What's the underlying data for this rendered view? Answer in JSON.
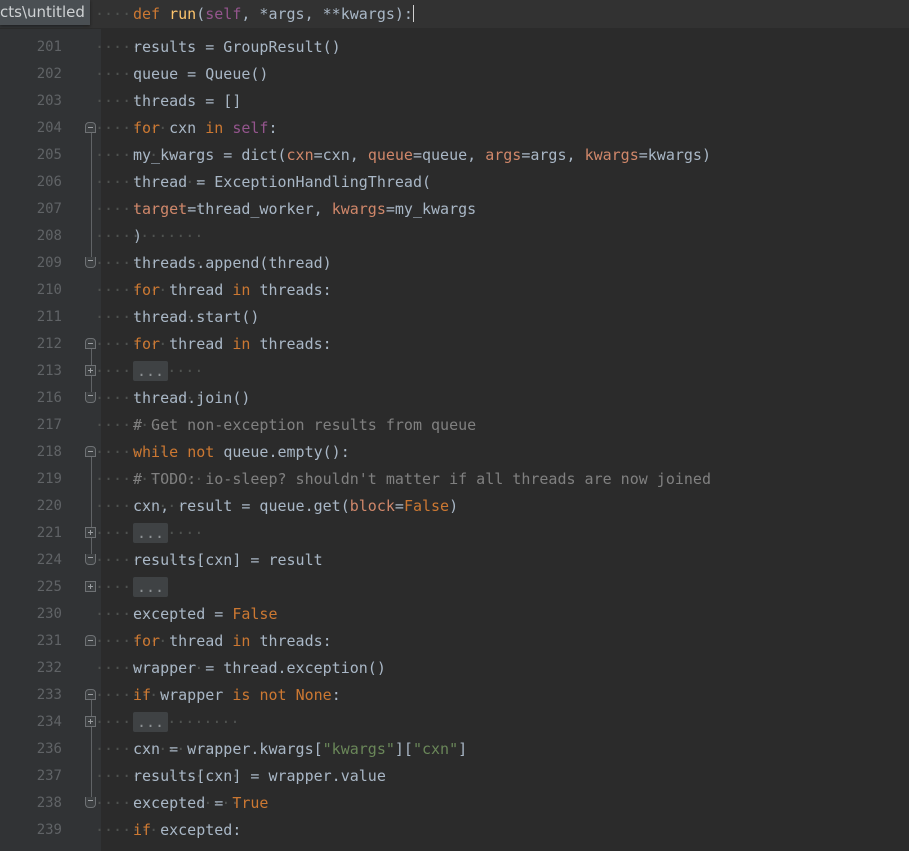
{
  "editor": {
    "language": "Python",
    "theme": "Darcula",
    "background": "#2b2b2b",
    "gutter_background": "#313335",
    "caret_color": "#d0d0d0"
  },
  "breadcrumb": {
    "text": "cts\\untitled"
  },
  "sticky_header": {
    "indent_guides": "····",
    "tokens": [
      {
        "t": "def ",
        "c": "kw"
      },
      {
        "t": "run",
        "c": "fn"
      },
      {
        "t": "(",
        "c": "op"
      },
      {
        "t": "self",
        "c": "self"
      },
      {
        "t": ", *args, **kwargs):",
        "c": "op"
      }
    ],
    "has_caret": true
  },
  "lines": [
    {
      "num": "201",
      "fold": "",
      "indent": "········",
      "tokens": [
        {
          "t": "results = GroupResult()",
          "c": "op"
        }
      ]
    },
    {
      "num": "202",
      "fold": "",
      "indent": "········",
      "tokens": [
        {
          "t": "queue = Queue()",
          "c": "op"
        }
      ]
    },
    {
      "num": "203",
      "fold": "",
      "indent": "········",
      "tokens": [
        {
          "t": "threads = []",
          "c": "op"
        }
      ]
    },
    {
      "num": "204",
      "fold": "open",
      "indent": "········",
      "tokens": [
        {
          "t": "for ",
          "c": "kw"
        },
        {
          "t": "cxn ",
          "c": "op"
        },
        {
          "t": "in ",
          "c": "kw"
        },
        {
          "t": "self",
          "c": "self"
        },
        {
          "t": ":",
          "c": "op"
        }
      ]
    },
    {
      "num": "205",
      "fold": "",
      "indent": "············",
      "tokens": [
        {
          "t": "my_kwargs = dict(",
          "c": "op"
        },
        {
          "t": "cxn",
          "c": "kwarg"
        },
        {
          "t": "=cxn, ",
          "c": "op"
        },
        {
          "t": "queue",
          "c": "kwarg"
        },
        {
          "t": "=queue, ",
          "c": "op"
        },
        {
          "t": "args",
          "c": "kwarg"
        },
        {
          "t": "=args, ",
          "c": "op"
        },
        {
          "t": "kwargs",
          "c": "kwarg"
        },
        {
          "t": "=kwargs)",
          "c": "op"
        }
      ]
    },
    {
      "num": "206",
      "fold": "",
      "indent": "············",
      "tokens": [
        {
          "t": "thread = ExceptionHandlingThread(",
          "c": "op"
        }
      ]
    },
    {
      "num": "207",
      "fold": "",
      "indent": "················",
      "tokens": [
        {
          "t": "target",
          "c": "kwarg"
        },
        {
          "t": "=thread_worker, ",
          "c": "op"
        },
        {
          "t": "kwargs",
          "c": "kwarg"
        },
        {
          "t": "=my_kwargs",
          "c": "op"
        }
      ]
    },
    {
      "num": "208",
      "fold": "",
      "indent": "············",
      "tokens": [
        {
          "t": ")",
          "c": "op"
        }
      ]
    },
    {
      "num": "209",
      "fold": "end",
      "indent": "············",
      "tokens": [
        {
          "t": "threads.append(thread)",
          "c": "op"
        }
      ]
    },
    {
      "num": "210",
      "fold": "",
      "indent": "········",
      "tokens": [
        {
          "t": "for ",
          "c": "kw"
        },
        {
          "t": "thread ",
          "c": "op"
        },
        {
          "t": "in ",
          "c": "kw"
        },
        {
          "t": "threads:",
          "c": "op"
        }
      ]
    },
    {
      "num": "211",
      "fold": "",
      "indent": "············",
      "tokens": [
        {
          "t": "thread.start()",
          "c": "op"
        }
      ]
    },
    {
      "num": "212",
      "fold": "open",
      "indent": "········",
      "tokens": [
        {
          "t": "for ",
          "c": "kw"
        },
        {
          "t": "thread ",
          "c": "op"
        },
        {
          "t": "in ",
          "c": "kw"
        },
        {
          "t": "threads:",
          "c": "op"
        }
      ]
    },
    {
      "num": "213",
      "fold": "closed",
      "indent": "············",
      "tokens": [
        {
          "t": "...",
          "c": "fold"
        }
      ]
    },
    {
      "num": "216",
      "fold": "end",
      "indent": "············",
      "tokens": [
        {
          "t": "thread.join()",
          "c": "op"
        }
      ]
    },
    {
      "num": "217",
      "fold": "",
      "indent": "········",
      "tokens": [
        {
          "t": "# Get non-exception results from queue",
          "c": "cmt"
        }
      ]
    },
    {
      "num": "218",
      "fold": "open",
      "indent": "········",
      "tokens": [
        {
          "t": "while ",
          "c": "kw"
        },
        {
          "t": "not ",
          "c": "kw"
        },
        {
          "t": "queue.empty():",
          "c": "op"
        }
      ]
    },
    {
      "num": "219",
      "fold": "",
      "indent": "············",
      "tokens": [
        {
          "t": "# TODO: io-sleep? shouldn't matter if all threads are now joined",
          "c": "cmt"
        }
      ]
    },
    {
      "num": "220",
      "fold": "",
      "indent": "············",
      "tokens": [
        {
          "t": "cxn, result = queue.get(",
          "c": "op"
        },
        {
          "t": "block",
          "c": "kwarg"
        },
        {
          "t": "=",
          "c": "op"
        },
        {
          "t": "False",
          "c": "const"
        },
        {
          "t": ")",
          "c": "op"
        }
      ]
    },
    {
      "num": "221",
      "fold": "closed",
      "indent": "············",
      "tokens": [
        {
          "t": "...",
          "c": "fold"
        }
      ]
    },
    {
      "num": "224",
      "fold": "end",
      "indent": "············",
      "tokens": [
        {
          "t": "results[cxn] = result",
          "c": "op"
        }
      ]
    },
    {
      "num": "225",
      "fold": "closed",
      "indent": "········",
      "tokens": [
        {
          "t": "...",
          "c": "fold"
        }
      ]
    },
    {
      "num": "230",
      "fold": "",
      "indent": "········",
      "tokens": [
        {
          "t": "excepted = ",
          "c": "op"
        },
        {
          "t": "False",
          "c": "const"
        }
      ]
    },
    {
      "num": "231",
      "fold": "open",
      "indent": "········",
      "tokens": [
        {
          "t": "for ",
          "c": "kw"
        },
        {
          "t": "thread ",
          "c": "op"
        },
        {
          "t": "in ",
          "c": "kw"
        },
        {
          "t": "threads:",
          "c": "op"
        }
      ]
    },
    {
      "num": "232",
      "fold": "",
      "indent": "············",
      "tokens": [
        {
          "t": "wrapper = thread.exception()",
          "c": "op"
        }
      ]
    },
    {
      "num": "233",
      "fold": "open",
      "indent": "············",
      "tokens": [
        {
          "t": "if ",
          "c": "kw"
        },
        {
          "t": "wrapper ",
          "c": "op"
        },
        {
          "t": "is ",
          "c": "kw"
        },
        {
          "t": "not ",
          "c": "kw"
        },
        {
          "t": "None",
          "c": "const"
        },
        {
          "t": ":",
          "c": "op"
        }
      ]
    },
    {
      "num": "234",
      "fold": "closed",
      "indent": "················",
      "tokens": [
        {
          "t": "...",
          "c": "fold"
        }
      ]
    },
    {
      "num": "236",
      "fold": "",
      "indent": "················",
      "tokens": [
        {
          "t": "cxn = wrapper.kwargs[",
          "c": "op"
        },
        {
          "t": "\"kwargs\"",
          "c": "str"
        },
        {
          "t": "][",
          "c": "op"
        },
        {
          "t": "\"cxn\"",
          "c": "str"
        },
        {
          "t": "]",
          "c": "op"
        }
      ]
    },
    {
      "num": "237",
      "fold": "",
      "indent": "················",
      "tokens": [
        {
          "t": "results[cxn] = wrapper.value",
          "c": "op"
        }
      ]
    },
    {
      "num": "238",
      "fold": "end",
      "indent": "················",
      "tokens": [
        {
          "t": "excepted = ",
          "c": "op"
        },
        {
          "t": "True",
          "c": "const"
        }
      ]
    },
    {
      "num": "239",
      "fold": "",
      "indent": "········",
      "tokens": [
        {
          "t": "if ",
          "c": "kw"
        },
        {
          "t": "excepted:",
          "c": "op"
        }
      ]
    }
  ]
}
